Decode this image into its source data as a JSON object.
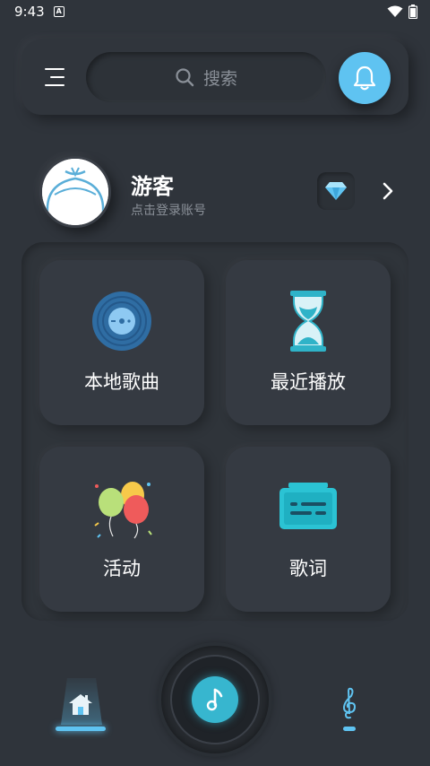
{
  "status_bar": {
    "time": "9:43",
    "indicator": "A"
  },
  "header": {
    "menu_icon": "menu-icon",
    "search_placeholder": "搜索",
    "bell_icon": "bell-icon"
  },
  "profile": {
    "name": "游客",
    "subtitle": "点击登录账号",
    "vip_icon": "diamond-icon"
  },
  "grid": {
    "items": [
      {
        "label": "本地歌曲",
        "icon": "vinyl-disc-icon"
      },
      {
        "label": "最近播放",
        "icon": "hourglass-icon"
      },
      {
        "label": "活动",
        "icon": "balloons-icon"
      },
      {
        "label": "歌词",
        "icon": "lyrics-screen-icon"
      }
    ]
  },
  "bottom_nav": {
    "items": [
      {
        "icon": "home-icon",
        "active": true
      },
      {
        "icon": "music-note-icon",
        "role": "player"
      },
      {
        "icon": "treble-clef-icon",
        "active": false
      }
    ]
  },
  "colors": {
    "background": "#2f343b",
    "accent": "#5fc3f1",
    "player_accent": "#37b6cf",
    "text_primary": "#ffffff",
    "text_secondary": "#8b9199"
  }
}
